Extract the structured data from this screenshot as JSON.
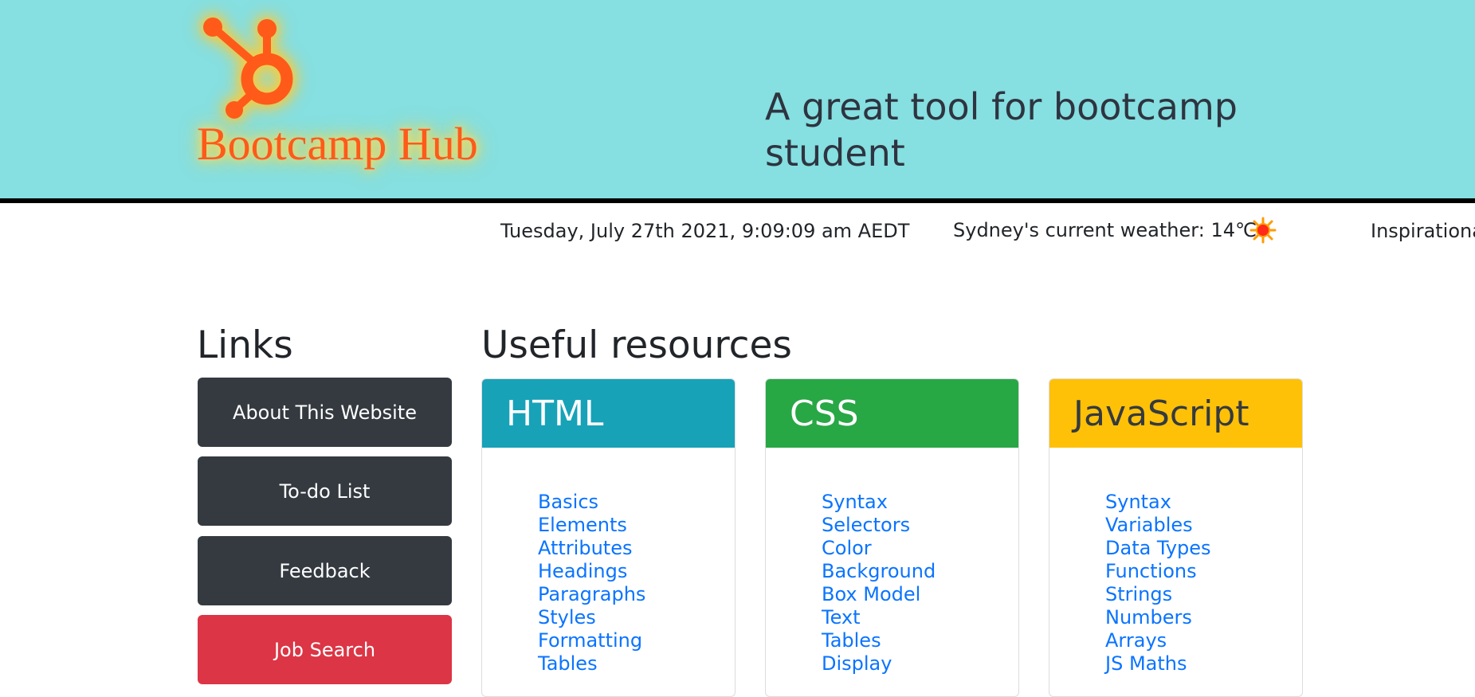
{
  "header": {
    "brand_name": "Bootcamp Hub",
    "tagline": "A great tool for bootcamp student",
    "logo_icon": "hubspot-sprocket-icon",
    "colors": {
      "header_bg": "#86dfe0",
      "brand": "#ff5a1a"
    }
  },
  "infobar": {
    "date_time": "Tuesday, July 27th 2021, 9:09:09 am AEDT",
    "weather": "Sydney's current weather: 14℃",
    "weather_icon": "sun-icon",
    "quote": "Inspirational"
  },
  "links": {
    "title": "Links",
    "buttons": [
      {
        "label": "About This Website",
        "color": "#343a40"
      },
      {
        "label": "To-do List",
        "color": "#343a40"
      },
      {
        "label": "Feedback",
        "color": "#343a40"
      },
      {
        "label": "Job Search",
        "color": "#dc3545"
      }
    ]
  },
  "resources": {
    "title": "Useful resources",
    "cards": [
      {
        "title": "HTML",
        "color": "#17a2b8",
        "text_color": "#ffffff",
        "items": [
          "Basics",
          "Elements",
          "Attributes",
          "Headings",
          "Paragraphs",
          "Styles",
          "Formatting",
          "Tables"
        ]
      },
      {
        "title": "CSS",
        "color": "#28a745",
        "text_color": "#ffffff",
        "items": [
          "Syntax",
          "Selectors",
          "Color",
          "Background",
          "Box Model",
          "Text",
          "Tables",
          "Display"
        ]
      },
      {
        "title": "JavaScript",
        "color": "#ffc107",
        "text_color": "#343a40",
        "items": [
          "Syntax",
          "Variables",
          "Data Types",
          "Functions",
          "Strings",
          "Numbers",
          "Arrays",
          "JS Maths"
        ]
      }
    ]
  }
}
